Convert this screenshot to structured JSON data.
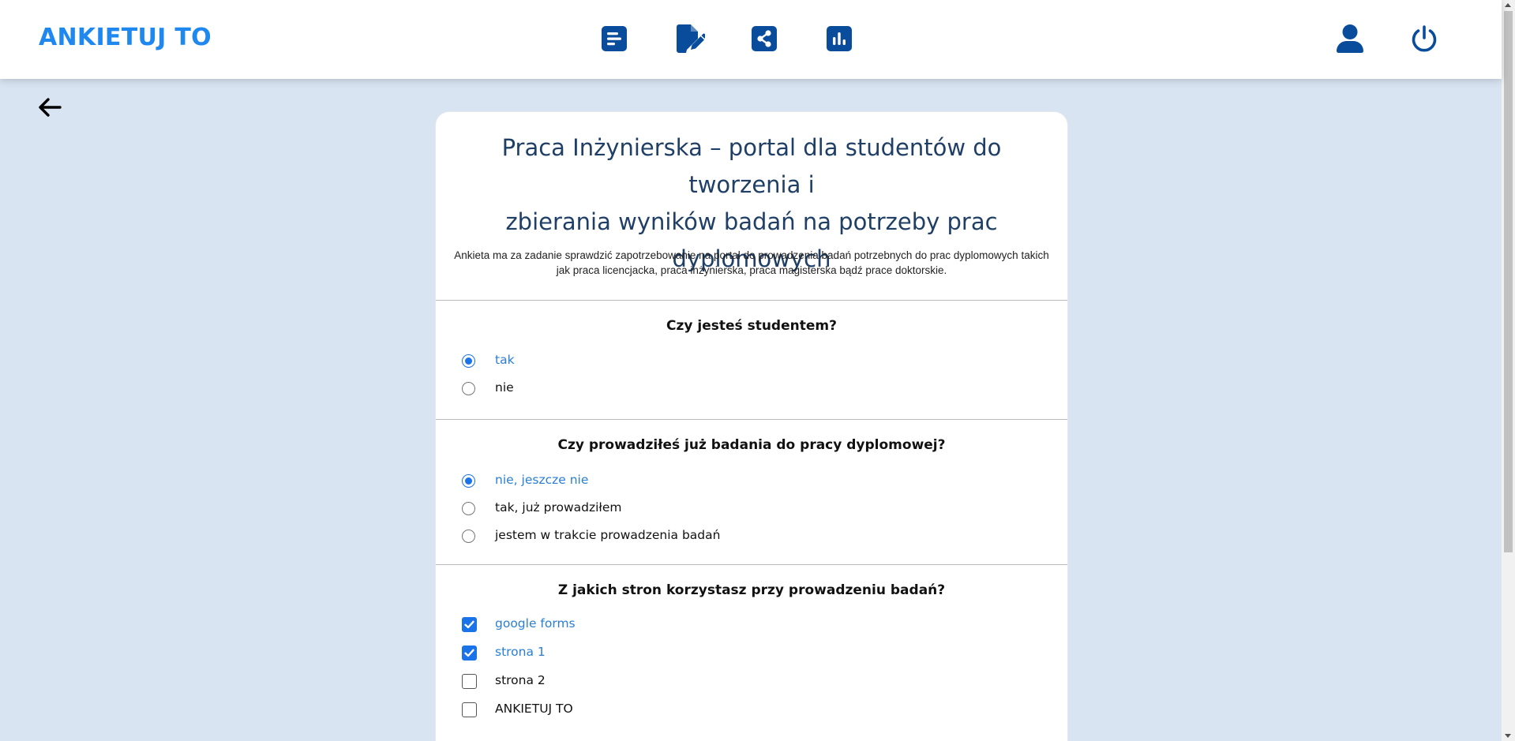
{
  "app": {
    "brand": "ANKIETUJ TO"
  },
  "header": {
    "icons": [
      {
        "name": "surveys-list-icon"
      },
      {
        "name": "edit-survey-icon"
      },
      {
        "name": "share-icon"
      },
      {
        "name": "results-chart-icon"
      }
    ],
    "right_icons": [
      {
        "name": "user-icon"
      },
      {
        "name": "power-icon"
      }
    ]
  },
  "colors": {
    "brand": "#1e88f0",
    "icon_blue": "#0a4c9c",
    "accent": "#1a73e8",
    "background": "#d9e4f2",
    "title": "#1f3f66"
  },
  "survey": {
    "title": "Praca Inżynierska - portal dla studentów do tworzenia i zbierania wyników badań na potrzeby prac dyplomowych",
    "title_lines": [
      "Praca Inżynierska – portal dla studentów do tworzenia i",
      "zbierania wyników badań na potrzeby prac",
      "dyplomowych"
    ],
    "description_lines": [
      "Ankieta ma za zadanie sprawdzić zapotrzebowanie na portal do prowadzenia badań potrzebnych do prac dyplomowych takich",
      "jak praca licencjacka, praca inżynierska, praca magisterska bądź prace doktorskie."
    ],
    "questions": [
      {
        "text": "Czy jesteś studentem?",
        "type": "radio",
        "options": [
          {
            "label": "tak",
            "checked": true
          },
          {
            "label": "nie",
            "checked": false
          }
        ]
      },
      {
        "text": "Czy prowadziłeś już badania do pracy dyplomowej?",
        "type": "radio",
        "options": [
          {
            "label": "nie, jeszcze nie",
            "checked": true
          },
          {
            "label": "tak, już prowadziłem",
            "checked": false
          },
          {
            "label": "jestem w trakcie prowadzenia badań",
            "checked": false
          }
        ]
      },
      {
        "text": "Z jakich stron korzystasz przy prowadzeniu badań?",
        "type": "checkbox",
        "options": [
          {
            "label": "google forms",
            "checked": true
          },
          {
            "label": "strona 1",
            "checked": true
          },
          {
            "label": "strona 2",
            "checked": false
          },
          {
            "label": "ANKIETUJ TO",
            "checked": false
          }
        ]
      }
    ]
  }
}
